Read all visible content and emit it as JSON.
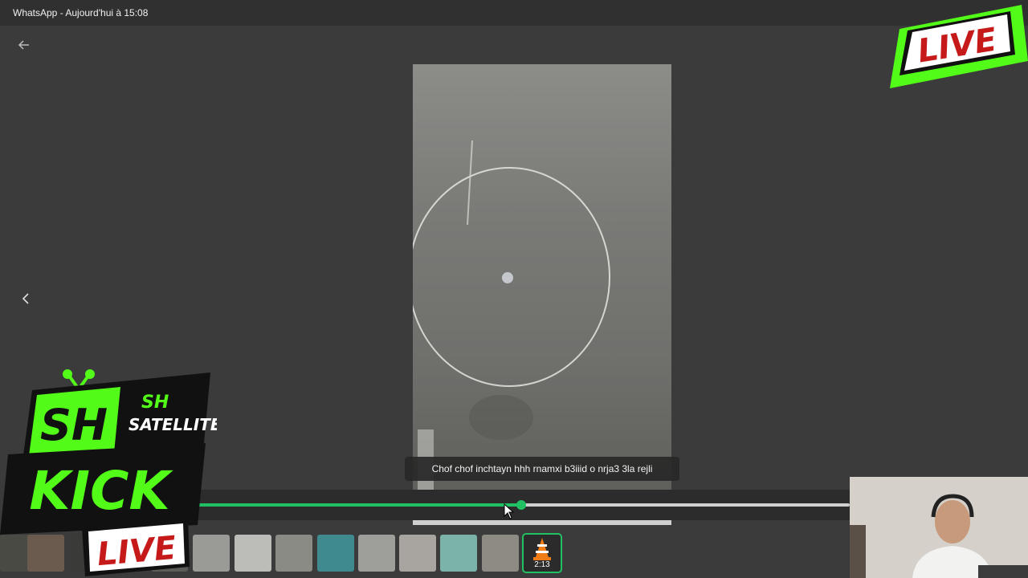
{
  "window": {
    "title": "WhatsApp - Aujourd'hui à 15:08"
  },
  "viewer": {
    "back_icon": "arrow-left-icon",
    "prev_icon": "chevron-left-icon",
    "caption": "Chof chof inchtayn hhh rnamxi b3iiid o nrja3 3la rejli",
    "progress_fraction": 0.5,
    "accent_color": "#21c063"
  },
  "thumbnails": {
    "active_duration": "2:13",
    "active_icon": "vlc-cone-icon"
  },
  "overlays": {
    "live_top": "LIVE",
    "brand_sh": "SH",
    "brand_satellite": "SATELLITE",
    "brand_kick": "KICK",
    "live_bottom": "LIVE",
    "brand_color": "#53fc18"
  }
}
